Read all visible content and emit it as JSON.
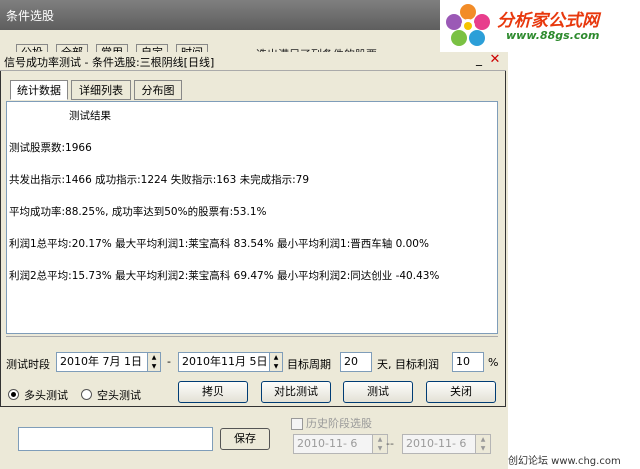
{
  "background_window": {
    "title": "条件选股",
    "tabs": [
      "公投",
      "全部",
      "常用",
      "自定",
      "时间"
    ],
    "desc": "选出满足了列条件的股票",
    "save_label": "保存",
    "checkbox_label": "历史阶段选股",
    "date_from": "2010-11- 6",
    "date_to": "2010-11- 6",
    "date_sep": "--"
  },
  "logo": {
    "text": "分析家公式网",
    "url": "www.88gs.com"
  },
  "dialog": {
    "title": "信号成功率测试 - 条件选股:三根阴线[日线]",
    "tabs": [
      "统计数据",
      "详细列表",
      "分布图"
    ],
    "results": {
      "heading": "测试结果",
      "line1": "测试股票数:1966",
      "line2": "共发出指示:1466 成功指示:1224 失败指示:163 未完成指示:79",
      "line3": "平均成功率:88.25%, 成功率达到50%的股票有:53.1%",
      "line4": "利润1总平均:20.17% 最大平均利润1:莱宝高科 83.54% 最小平均利润1:晋西车轴 0.00%",
      "line5": "利润2总平均:15.73% 最大平均利润2:莱宝高科 69.47% 最小平均利润2:同达创业 -40.43%"
    },
    "period_label": "测试时段",
    "date_from": "2010年 7月 1日",
    "date_sep": "-",
    "date_to": "2010年11月 5日",
    "target_period_label": "目标周期",
    "target_period_value": "20",
    "days_label": "天, 目标利润",
    "target_profit_value": "10",
    "percent": "%",
    "radio_long": "多头测试",
    "radio_short": "空头测试",
    "btn_copy": "拷贝",
    "btn_compare": "对比测试",
    "btn_test": "测试",
    "btn_close": "关闭",
    "minimize": "_",
    "close": "✕"
  },
  "footer_text": "创幻论坛 www.chg.com",
  "colors": {
    "accent": "#e8380d",
    "title_bar": "#6e6e6e",
    "dialog_bg": "#ece9d8"
  }
}
